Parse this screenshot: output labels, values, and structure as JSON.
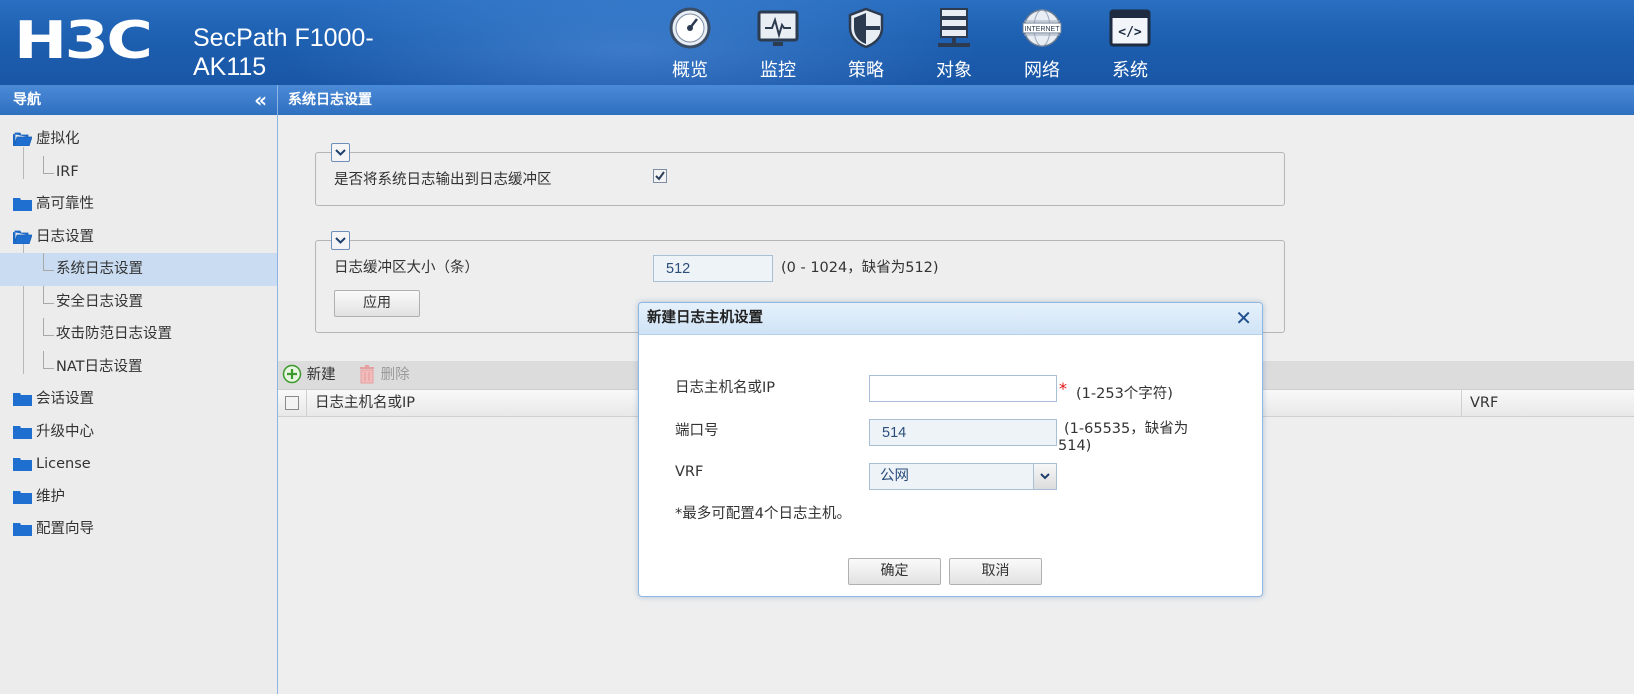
{
  "header": {
    "logo": "H3C",
    "product_name": "SecPath F1000-AK115",
    "nav": [
      {
        "label": "概览",
        "icon": "dashboard-icon"
      },
      {
        "label": "监控",
        "icon": "monitor-icon"
      },
      {
        "label": "策略",
        "icon": "shield-icon"
      },
      {
        "label": "对象",
        "icon": "server-icon"
      },
      {
        "label": "网络",
        "icon": "internet-globe-icon"
      },
      {
        "label": "系统",
        "icon": "code-window-icon"
      }
    ],
    "nav_active": "系统",
    "internet_badge_text": "INTERNET",
    "code_badge_text": "</>"
  },
  "sidebar": {
    "title": "导航",
    "collapse_glyph": "«",
    "items": [
      {
        "label": "虚拟化",
        "level": 0,
        "open": true
      },
      {
        "label": "IRF",
        "level": 1
      },
      {
        "label": "高可靠性",
        "level": 0
      },
      {
        "label": "日志设置",
        "level": 0,
        "open": true
      },
      {
        "label": "系统日志设置",
        "level": 1,
        "selected": true
      },
      {
        "label": "安全日志设置",
        "level": 1
      },
      {
        "label": "攻击防范日志设置",
        "level": 1
      },
      {
        "label": "NAT日志设置",
        "level": 1
      },
      {
        "label": "会话设置",
        "level": 0
      },
      {
        "label": "升级中心",
        "level": 0
      },
      {
        "label": "License",
        "level": 0
      },
      {
        "label": "维护",
        "level": 0
      },
      {
        "label": "配置向导",
        "level": 0
      }
    ]
  },
  "main": {
    "title": "系统日志设置",
    "buffer_output_label": "是否将系统日志输出到日志缓冲区",
    "buffer_output_checked": true,
    "buffer_size_label": "日志缓冲区大小（条）",
    "buffer_size_value": "512",
    "buffer_size_hint": "(0 - 1024，缺省为512)",
    "apply_label": "应用",
    "toolbar": {
      "new_label": "新建",
      "delete_label": "删除"
    },
    "table": {
      "columns": [
        "日志主机名或IP",
        "VRF"
      ]
    }
  },
  "dialog": {
    "title": "新建日志主机设置",
    "close_glyph": "✕",
    "host_label": "日志主机名或IP",
    "host_value": "",
    "host_required": "*",
    "host_hint": "(1-253个字符)",
    "port_label": "端口号",
    "port_value": "514",
    "port_hint_line1": "(1-65535，缺省为",
    "port_hint_line2": "514)",
    "vrf_label": "VRF",
    "vrf_value": "公网",
    "note": "*最多可配置4个日志主机。",
    "ok_label": "确定",
    "cancel_label": "取消"
  },
  "colors": {
    "header_blue": "#1d5fb0",
    "panel_head_blue": "#2f6fc0",
    "selected_row": "#c9dcf2",
    "required_red": "#e01010",
    "folder_blue": "#1e6fd0"
  }
}
